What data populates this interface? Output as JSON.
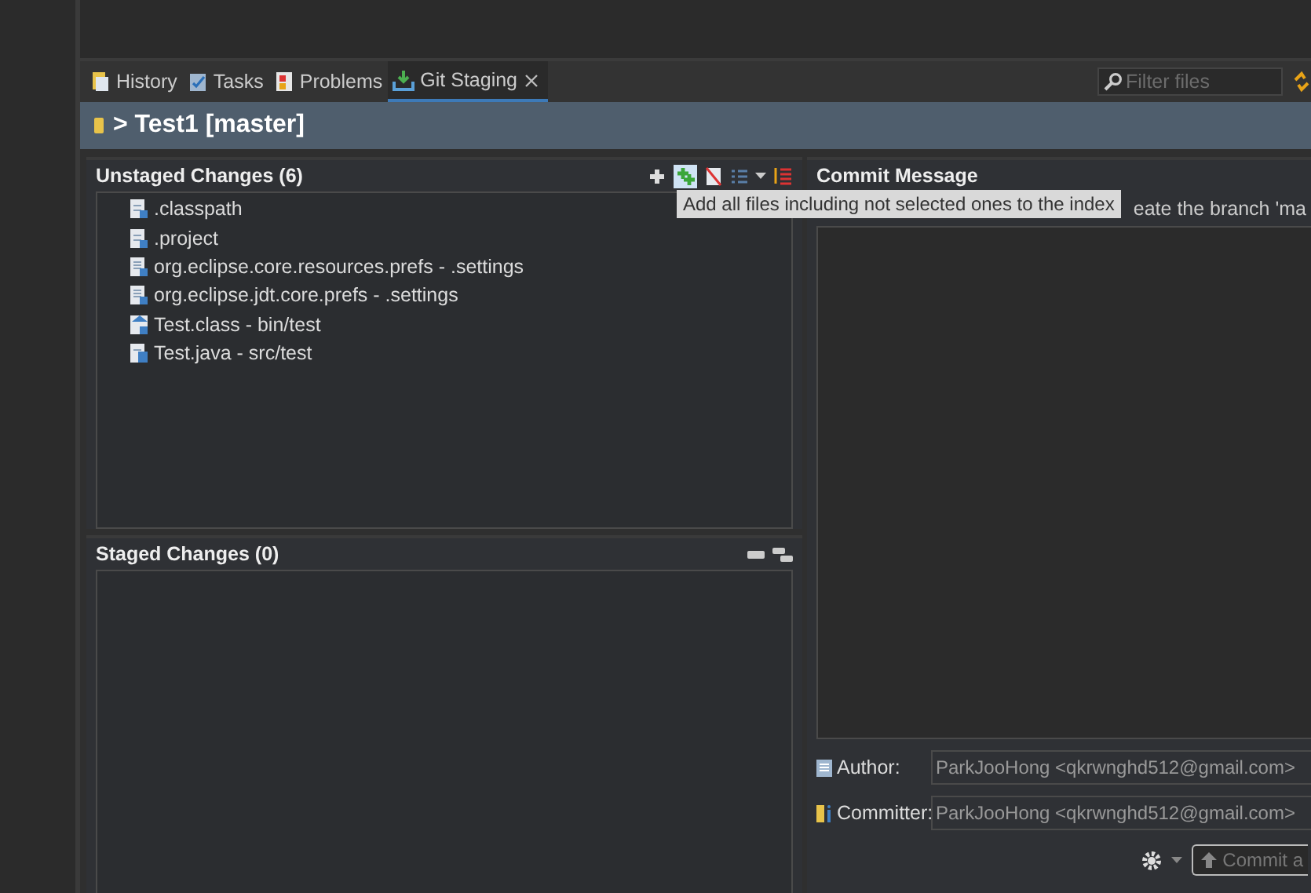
{
  "tabs": [
    {
      "label": "History",
      "selected": false
    },
    {
      "label": "Tasks",
      "selected": false
    },
    {
      "label": "Problems",
      "selected": false
    },
    {
      "label": "Git Staging",
      "selected": true
    }
  ],
  "filter": {
    "placeholder": "Filter files"
  },
  "header": {
    "title": "> Test1 [master]"
  },
  "unstaged": {
    "title": "Unstaged Changes (6)",
    "files": [
      {
        "name": ".classpath",
        "kind": "xml"
      },
      {
        "name": ".project",
        "kind": "xml"
      },
      {
        "name": "org.eclipse.core.resources.prefs - .settings",
        "kind": "text"
      },
      {
        "name": "org.eclipse.jdt.core.prefs - .settings",
        "kind": "text"
      },
      {
        "name": "Test.class - bin/test",
        "kind": "class"
      },
      {
        "name": "Test.java - src/test",
        "kind": "java"
      }
    ]
  },
  "tooltip": {
    "text": "Add all files including not selected ones to the index"
  },
  "staged": {
    "title": "Staged Changes (0)"
  },
  "commit": {
    "title": "Commit Message",
    "note": "eate the branch 'ma",
    "author": {
      "label": "Author:",
      "value": "ParkJooHong  <qkrwnghd512@gmail.com>"
    },
    "committer": {
      "label": "Committer:",
      "value": "ParkJooHong  <qkrwnghd512@gmail.com>"
    },
    "button": "Commit a"
  }
}
